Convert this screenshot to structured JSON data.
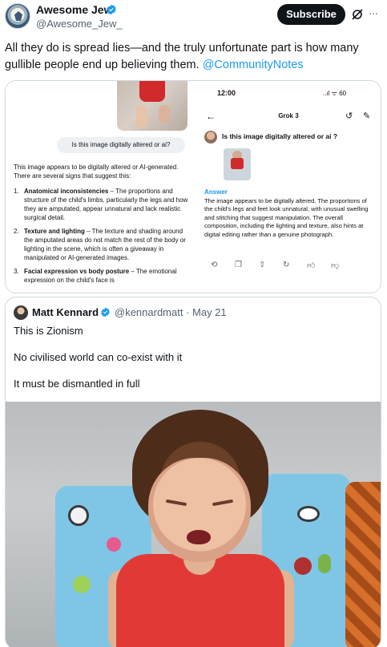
{
  "post": {
    "author_name": "Awesome Jew",
    "author_handle": "@Awesome_Jew_",
    "subscribe_label": "Subscribe",
    "more_label": "···",
    "text": "All they do is spread lies—and the truly unfortunate part is how many gullible people end up believing them.",
    "mention": "@CommunityNotes"
  },
  "media_left": {
    "question": "Is this image digitally altered or ai?",
    "intro": "This image appears to be digitally altered or AI-generated. There are several signs that suggest this:",
    "items": [
      {
        "num": "1.",
        "title": "Anatomical inconsistencies",
        "text": " – The proportions and structure of the child's limbs, particularly the legs and how they are amputated, appear unnatural and lack realistic surgical detail."
      },
      {
        "num": "2.",
        "title": "Texture and lighting",
        "text": " – The texture and shading around the amputated areas do not match the rest of the body or lighting in the scene, which is often a giveaway in manipulated or AI-generated images."
      },
      {
        "num": "3.",
        "title": "Facial expression vs body posture",
        "text": " – The emotional expression on the child's face is"
      }
    ]
  },
  "media_right": {
    "time": "12:00",
    "status": "..ıl ᯤ 60",
    "app_title": "Grok 3",
    "question": "Is this image digitally altered or ai ?",
    "answer_label": "Answer",
    "answer": "The image appears to be digitally altered. The proportions of the child's legs and feet look unnatural, with unusual swelling and stitching that suggest manipulation. The overall composition, including the lighting and texture, also hints at digital editing rather than a genuine photograph."
  },
  "quote": {
    "author_name": "Matt Kennard",
    "author_handle": "@kennardmatt · May 21",
    "lines": [
      "This is Zionism",
      "No civilised world can co-exist with it",
      "It must be dismantled in full"
    ]
  },
  "colors": {
    "link": "#1d9bf0",
    "verified": "#1d9bf0",
    "text": "#0f1419",
    "muted": "#536471",
    "border": "#cfd9de"
  },
  "icons": [
    "verified-badge-icon",
    "grok-icon",
    "more-icon",
    "back-arrow-icon",
    "history-icon",
    "edit-icon",
    "regenerate-icon",
    "copy-icon",
    "share-icon",
    "refresh-icon",
    "thumbs-up-icon",
    "thumbs-down-icon"
  ]
}
